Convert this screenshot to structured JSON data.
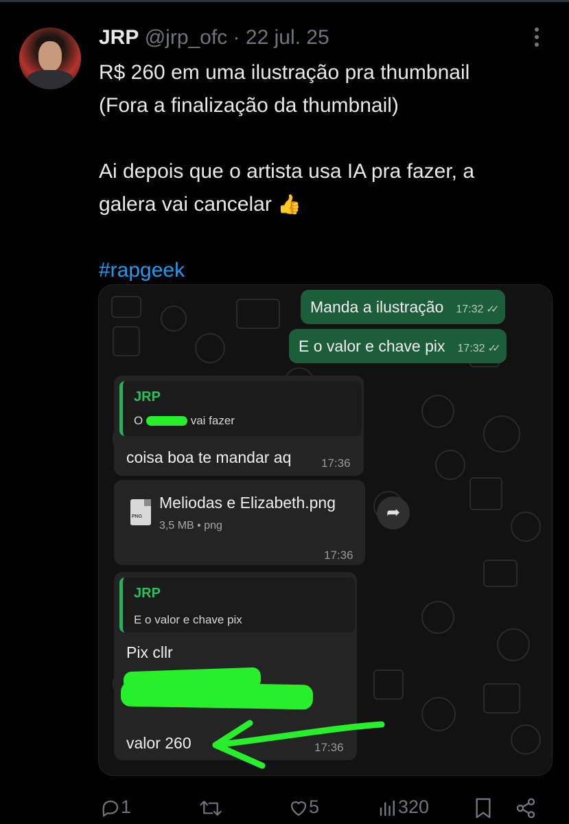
{
  "tweet": {
    "display_name": "JRP",
    "handle": "@jrp_ofc",
    "separator": "·",
    "date": "22 jul. 25",
    "lines": [
      "R$ 260 em uma ilustração pra thumbnail",
      "(Fora a finalização da thumbnail)",
      "Ai depois que o artista usa IA pra fazer, a",
      "galera vai cancelar"
    ],
    "emoji": "👍",
    "hashtag": "#rapgeek"
  },
  "chat": {
    "outgoing": [
      {
        "text": "Manda a ilustração",
        "time": "17:32"
      },
      {
        "text": "E o valor e chave pix",
        "time": "17:32"
      }
    ],
    "reply1": {
      "quote_name": "JRP",
      "quote_prefix": "O",
      "quote_suffix": "vai fazer",
      "text": "coisa boa te mandar aq",
      "time": "17:36"
    },
    "file": {
      "icon_label": "PNG",
      "name": "Meliodas e Elizabeth.png",
      "meta": "3,5 MB • png",
      "time": "17:36"
    },
    "reply2": {
      "quote_name": "JRP",
      "quote_text": "E o valor e chave pix",
      "text": "Pix cllr",
      "value_text": "valor 260",
      "time": "17:36"
    }
  },
  "actions": {
    "replies": "1",
    "reposts": "",
    "likes": "5",
    "views": "320"
  },
  "colors": {
    "background": "#000000",
    "hashtag": "#1d9bf0",
    "outgoing_bubble": "#1d5e3a",
    "incoming_bubble": "#242424",
    "quote_accent": "#25b35a",
    "scribble": "#27ef2b",
    "icon_gray": "#71767b"
  }
}
